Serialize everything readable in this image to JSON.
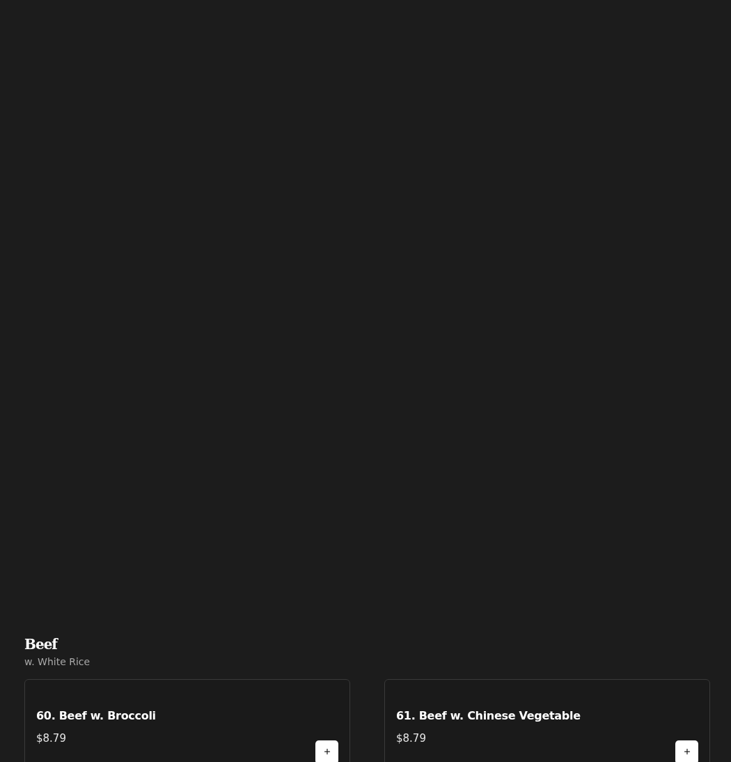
{
  "section": {
    "title": "Beef",
    "subtitle": "w. White Rice"
  },
  "items": [
    {
      "name": "60. Beef w. Broccoli",
      "price": "$8.79"
    },
    {
      "name": "61. Beef w. Chinese Vegetable",
      "price": "$8.79"
    }
  ]
}
